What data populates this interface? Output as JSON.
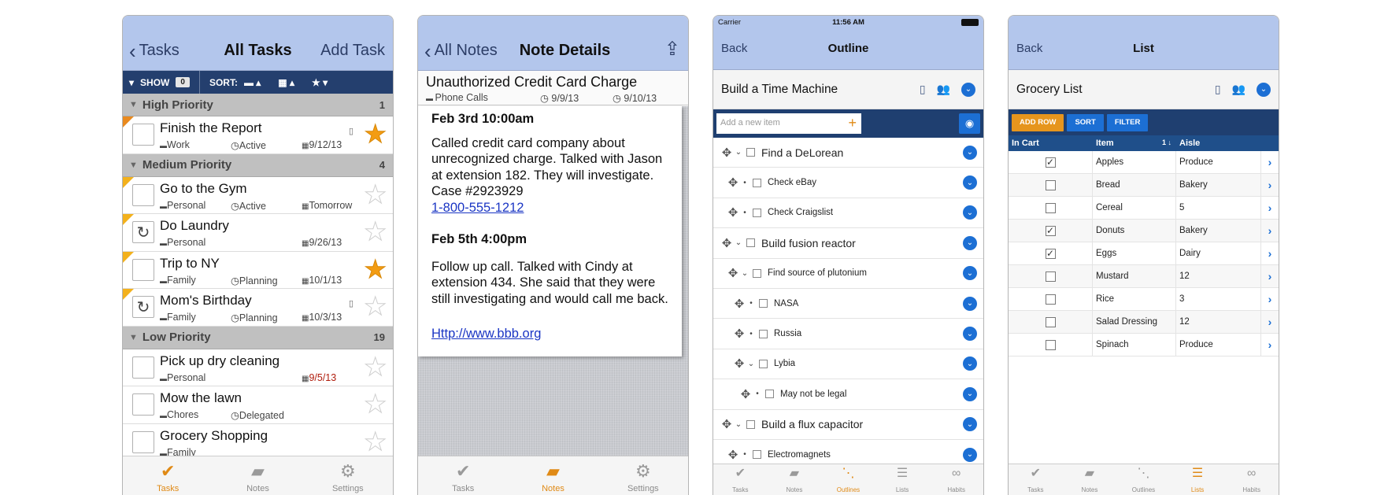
{
  "phone1": {
    "nav": {
      "back": "Tasks",
      "title": "All Tasks",
      "right": "Add Task"
    },
    "filter": {
      "show": "SHOW",
      "count": "0",
      "sort": "SORT:"
    },
    "sections": [
      {
        "title": "High Priority",
        "count": "1",
        "tasks": [
          {
            "name": "Finish the Report",
            "context": "Work",
            "status": "Active",
            "date": "9/12/13",
            "starred": true,
            "flag": "orange",
            "note": true
          }
        ]
      },
      {
        "title": "Medium Priority",
        "count": "4",
        "tasks": [
          {
            "name": "Go to the Gym",
            "context": "Personal",
            "status": "Active",
            "date": "Tomorrow",
            "starred": false,
            "flag": "yellow"
          },
          {
            "name": "Do Laundry",
            "context": "Personal",
            "status": "",
            "date": "9/26/13",
            "starred": false,
            "flag": "yellow",
            "repeat": true
          },
          {
            "name": "Trip to NY",
            "context": "Family",
            "status": "Planning",
            "date": "10/1/13",
            "starred": true,
            "flag": "yellow"
          },
          {
            "name": "Mom's Birthday",
            "context": "Family",
            "status": "Planning",
            "date": "10/3/13",
            "starred": false,
            "flag": "yellow",
            "repeat": true,
            "note": true
          }
        ]
      },
      {
        "title": "Low Priority",
        "count": "19",
        "tasks": [
          {
            "name": "Pick up dry cleaning",
            "context": "Personal",
            "status": "",
            "date": "9/5/13",
            "overdue": true,
            "starred": false
          },
          {
            "name": "Mow the lawn",
            "context": "Chores",
            "status": "Delegated",
            "date": "",
            "starred": false
          },
          {
            "name": "Grocery Shopping",
            "context": "Family",
            "status": "",
            "date": "",
            "starred": false
          }
        ]
      }
    ],
    "tabs": [
      {
        "label": "Tasks",
        "active": true
      },
      {
        "label": "Notes"
      },
      {
        "label": "Settings"
      }
    ]
  },
  "phone2": {
    "nav": {
      "back": "All Notes",
      "title": "Note Details"
    },
    "note": {
      "title": "Unauthorized Credit Card Charge",
      "folder": "Phone Calls",
      "created": "9/9/13",
      "modified": "9/10/13"
    },
    "body": {
      "h1": "Feb  3rd 10:00am",
      "p1": "Called credit card company about unrecognized charge. Talked with Jason at extension 182. They will investigate. Case #2923929",
      "phone": "1-800-555-1212",
      "h2": "Feb  5th 4:00pm",
      "p2": "Follow up call. Talked with Cindy at extension 434. She said that they were still investigating and would call me back.",
      "link": "Http://www.bbb.org"
    },
    "tabs": [
      {
        "label": "Tasks"
      },
      {
        "label": "Notes",
        "active": true
      },
      {
        "label": "Settings"
      }
    ]
  },
  "phone3": {
    "status": {
      "carrier": "Carrier",
      "time": "11:56 AM"
    },
    "nav": {
      "back": "Back",
      "title": "Outline"
    },
    "outline_title": "Build a Time Machine",
    "add_placeholder": "Add a new item",
    "items": [
      {
        "text": "Find a DeLorean",
        "level": 0,
        "big": true,
        "expand": true
      },
      {
        "text": "Check eBay",
        "level": 1
      },
      {
        "text": "Check Craigslist",
        "level": 1
      },
      {
        "text": "Build fusion reactor",
        "level": 0,
        "big": true,
        "expand": true
      },
      {
        "text": "Find source of plutonium",
        "level": 1,
        "expand": true
      },
      {
        "text": "NASA",
        "level": 2
      },
      {
        "text": "Russia",
        "level": 2
      },
      {
        "text": "Lybia",
        "level": 2,
        "expand": true
      },
      {
        "text": "May not be legal",
        "level": 3
      },
      {
        "text": "Build a flux capacitor",
        "level": 0,
        "big": true,
        "expand": true
      },
      {
        "text": "Electromagnets",
        "level": 1
      }
    ],
    "tabs": [
      {
        "label": "Tasks"
      },
      {
        "label": "Notes"
      },
      {
        "label": "Outlines",
        "active": true
      },
      {
        "label": "Lists"
      },
      {
        "label": "Habits"
      }
    ]
  },
  "phone4": {
    "nav": {
      "back": "Back",
      "title": "List"
    },
    "list_title": "Grocery List",
    "buttons": {
      "add": "ADD ROW",
      "sort": "SORT",
      "filter": "FILTER"
    },
    "columns": {
      "c1": "In Cart",
      "c2": "Item",
      "c3": "Aisle"
    },
    "rows": [
      {
        "cart": true,
        "item": "Apples",
        "aisle": "Produce"
      },
      {
        "cart": false,
        "item": "Bread",
        "aisle": "Bakery"
      },
      {
        "cart": false,
        "item": "Cereal",
        "aisle": "5"
      },
      {
        "cart": true,
        "item": "Donuts",
        "aisle": "Bakery"
      },
      {
        "cart": true,
        "item": "Eggs",
        "aisle": "Dairy"
      },
      {
        "cart": false,
        "item": "Mustard",
        "aisle": "12"
      },
      {
        "cart": false,
        "item": "Rice",
        "aisle": "3"
      },
      {
        "cart": false,
        "item": "Salad Dressing",
        "aisle": "12"
      },
      {
        "cart": false,
        "item": "Spinach",
        "aisle": "Produce"
      }
    ],
    "tabs": [
      {
        "label": "Tasks"
      },
      {
        "label": "Notes"
      },
      {
        "label": "Outlines"
      },
      {
        "label": "Lists",
        "active": true
      },
      {
        "label": "Habits"
      }
    ]
  },
  "colors": {
    "accent": "#e08a16",
    "nav": "#b3c6ec",
    "dark_bar": "#1f3f70",
    "blue": "#1c6fd4"
  }
}
